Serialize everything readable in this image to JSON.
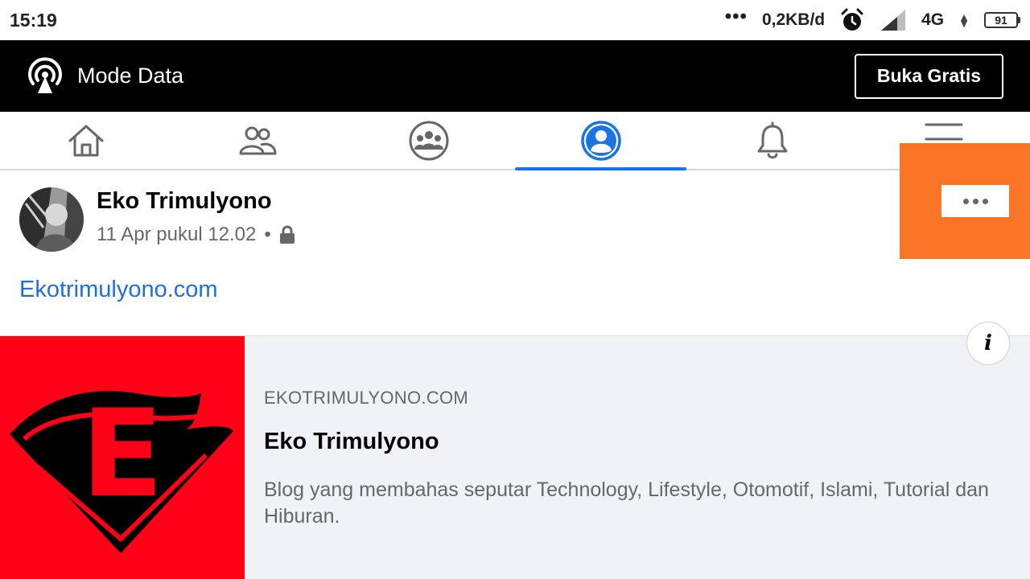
{
  "status_bar": {
    "time": "15:19",
    "dots": "•••",
    "speed": "0,2KB/d",
    "network": "4G",
    "battery": "91"
  },
  "banner": {
    "title": "Mode Data",
    "button_label": "Buka Gratis"
  },
  "nav": {
    "tabs": [
      {
        "icon": "home-icon",
        "active": false
      },
      {
        "icon": "friends-icon",
        "active": false
      },
      {
        "icon": "groups-icon",
        "active": false
      },
      {
        "icon": "profile-icon",
        "active": true
      },
      {
        "icon": "notifications-icon",
        "active": false
      },
      {
        "icon": "menu-icon",
        "active": false
      }
    ]
  },
  "post": {
    "author": "Eko Trimulyono",
    "timestamp": "11 Apr pukul 12.02",
    "separator": "•",
    "link_text": "Ekotrimulyono.com"
  },
  "preview": {
    "domain": "EKOTRIMULYONO.COM",
    "title": "Eko Trimulyono",
    "description": "Blog yang membahas seputar Technology, Lifestyle, Otomotif, Islami, Tutorial dan Hiburan.",
    "logo_letter": "E"
  },
  "colors": {
    "accent": "#1b74e4",
    "link": "#216fdb",
    "overlay": "#fa7626",
    "logo_red": "#ff0017"
  }
}
